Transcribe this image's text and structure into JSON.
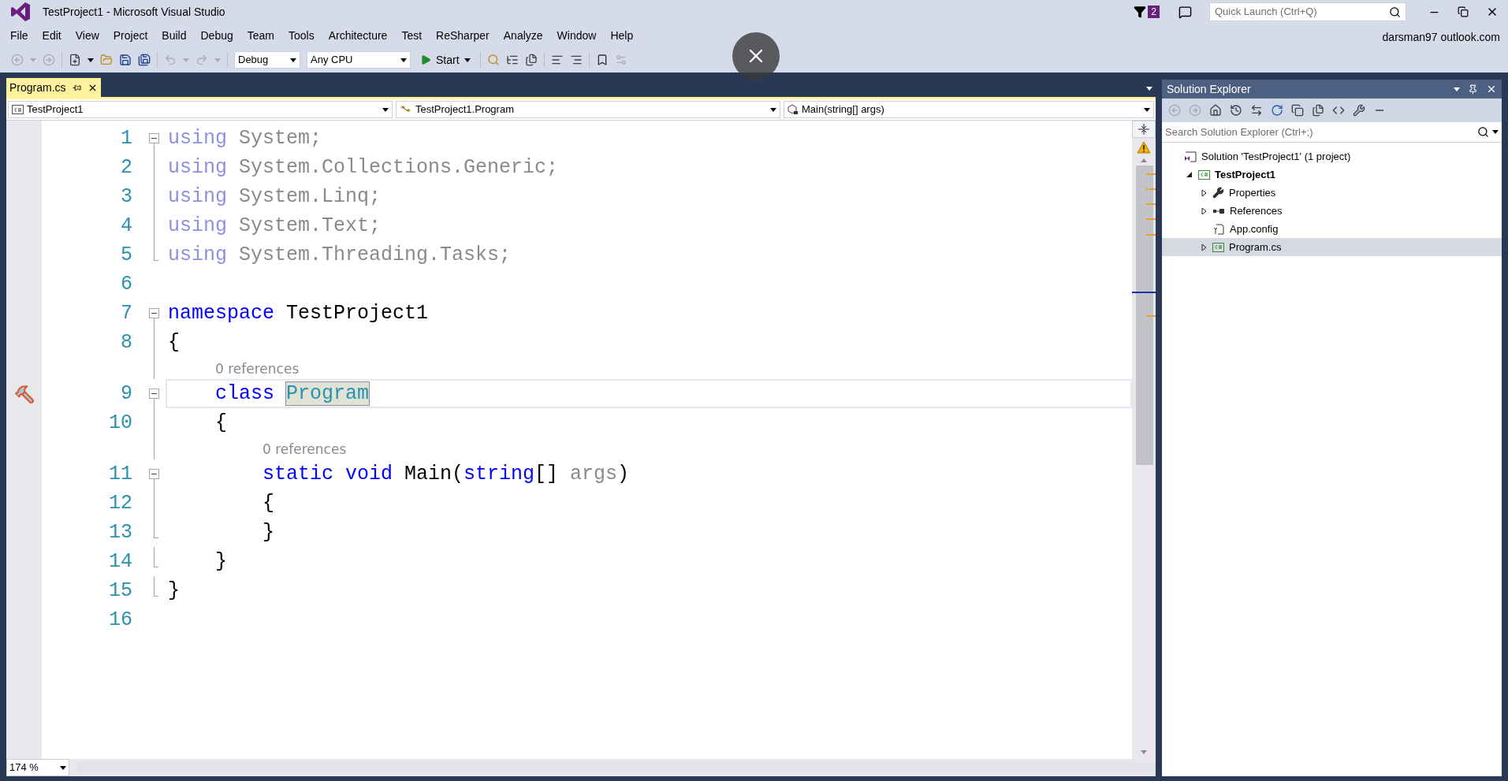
{
  "window": {
    "title": "TestProject1 - Microsoft Visual Studio",
    "notification_count": "2",
    "quick_launch": {
      "placeholder": "Quick Launch (Ctrl+Q)"
    },
    "account": "darsman97 outlook.com"
  },
  "menu": [
    "File",
    "Edit",
    "View",
    "Project",
    "Build",
    "Debug",
    "Team",
    "Tools",
    "Architecture",
    "Test",
    "ReSharper",
    "Analyze",
    "Window",
    "Help"
  ],
  "toolbar": {
    "configuration": "Debug",
    "platform": "Any CPU",
    "start": "Start"
  },
  "editor": {
    "tabs": [
      {
        "label": "Program.cs",
        "selected": true
      }
    ],
    "project_dropdown": "TestProject1",
    "class_dropdown": "TestProject1.Program",
    "member_dropdown": "Main(string[] args)",
    "lines": [
      {
        "number": "1",
        "kind": "fold_start",
        "current": false,
        "tokens": [
          {
            "kind": "dim_keyword",
            "text": "using"
          },
          {
            "kind": "dim",
            "text": " System;"
          }
        ]
      },
      {
        "number": "2",
        "kind": "fold_guide",
        "current": false,
        "tokens": [
          {
            "kind": "dim_keyword",
            "text": "using"
          },
          {
            "kind": "dim",
            "text": " System.Collections.Generic;"
          }
        ]
      },
      {
        "number": "3",
        "kind": "fold_guide",
        "current": false,
        "tokens": [
          {
            "kind": "dim_keyword",
            "text": "using"
          },
          {
            "kind": "dim",
            "text": " System.Linq;"
          }
        ]
      },
      {
        "number": "4",
        "kind": "fold_guide",
        "current": false,
        "tokens": [
          {
            "kind": "dim_keyword",
            "text": "using"
          },
          {
            "kind": "dim",
            "text": " System.Text;"
          }
        ]
      },
      {
        "number": "5",
        "kind": "fold_end",
        "current": false,
        "tokens": [
          {
            "kind": "dim_keyword",
            "text": "using"
          },
          {
            "kind": "dim",
            "text": " System.Threading.Tasks;"
          }
        ]
      },
      {
        "number": "6",
        "kind": "plain",
        "current": false
      },
      {
        "number": "7",
        "kind": "fold_start",
        "current": false,
        "tokens": [
          {
            "kind": "keyword",
            "text": "namespace"
          },
          {
            "kind": "plain",
            "text": " TestProject1"
          }
        ]
      },
      {
        "number": "8",
        "kind": "fold_guide",
        "current": false,
        "tokens": [
          {
            "kind": "plain",
            "text": "{"
          }
        ]
      },
      {
        "number": "9",
        "kind": "fold_start",
        "current": true,
        "code_lens": "0 references",
        "tokens": [
          {
            "kind": "keyword",
            "text": "    class "
          },
          {
            "kind": "type_highlight",
            "text": "Program"
          }
        ]
      },
      {
        "number": "10",
        "kind": "fold_guide",
        "current": false,
        "tokens": [
          {
            "kind": "plain",
            "text": "    {"
          }
        ]
      },
      {
        "number": "11",
        "kind": "fold_start",
        "current": false,
        "code_lens": "0 references",
        "tokens": [
          {
            "kind": "keyword",
            "text": "        static void"
          },
          {
            "kind": "plain",
            "text": " Main("
          },
          {
            "kind": "keyword",
            "text": "string"
          },
          {
            "kind": "plain",
            "text": "[] "
          },
          {
            "kind": "dim",
            "text": "args"
          },
          {
            "kind": "plain",
            "text": ")"
          }
        ]
      },
      {
        "number": "12",
        "kind": "fold_guide",
        "current": false,
        "tokens": [
          {
            "kind": "plain",
            "text": "        {"
          }
        ]
      },
      {
        "number": "13",
        "kind": "fold_end",
        "current": false,
        "tokens": [
          {
            "kind": "plain",
            "text": "        }"
          }
        ]
      },
      {
        "number": "14",
        "kind": "fold_end",
        "current": false,
        "tokens": [
          {
            "kind": "plain",
            "text": "    }"
          }
        ]
      },
      {
        "number": "15",
        "kind": "fold_end",
        "current": false,
        "tokens": [
          {
            "kind": "plain",
            "text": "}"
          }
        ]
      },
      {
        "number": "16",
        "kind": "plain",
        "current": false
      }
    ],
    "zoom": "174 %"
  },
  "solution_explorer": {
    "title": "Solution Explorer",
    "search": {
      "placeholder": "Search Solution Explorer (Ctrl+;)"
    },
    "tree": [
      {
        "label": "Solution 'TestProject1' (1 project)",
        "kind": "solution",
        "selected": false,
        "children": [
          {
            "label": "TestProject1",
            "kind": "project",
            "selected": false,
            "expanded": true,
            "children": [
              {
                "label": "Properties",
                "kind": "properties",
                "selected": false,
                "expanded": false
              },
              {
                "label": "References",
                "kind": "references",
                "selected": false,
                "expanded": false
              },
              {
                "label": "App.config",
                "kind": "config",
                "selected": false
              },
              {
                "label": "Program.cs",
                "kind": "csharp",
                "selected": true,
                "expanded": false
              }
            ]
          }
        ]
      }
    ]
  }
}
